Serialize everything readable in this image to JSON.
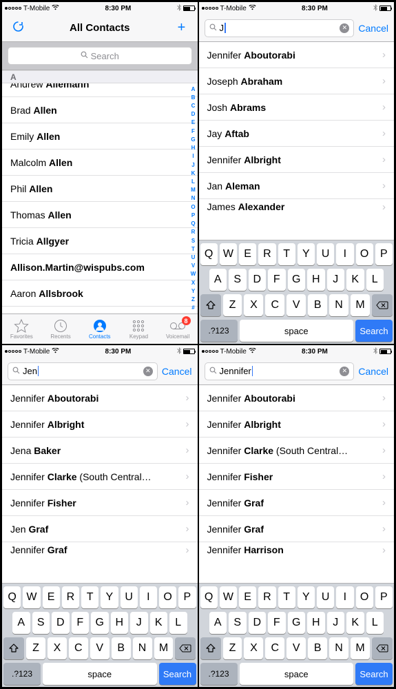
{
  "status": {
    "carrier": "T-Mobile",
    "time": "8:30 PM"
  },
  "screen1": {
    "title": "All Contacts",
    "search_placeholder": "Search",
    "section": "A",
    "rows": [
      {
        "first": "Andrew",
        "last": "Allemann",
        "cut": true
      },
      {
        "first": "Brad",
        "last": "Allen"
      },
      {
        "first": "Emily",
        "last": "Allen"
      },
      {
        "first": "Malcolm",
        "last": "Allen"
      },
      {
        "first": "Phil",
        "last": "Allen"
      },
      {
        "first": "Thomas",
        "last": "Allen"
      },
      {
        "first": "Tricia",
        "last": "Allgyer"
      },
      {
        "first": "",
        "last": "Allison.Martin@wispubs.com"
      },
      {
        "first": "Aaron",
        "last": "Allsbrook"
      }
    ],
    "index": [
      "A",
      "B",
      "C",
      "D",
      "E",
      "F",
      "G",
      "H",
      "I",
      "J",
      "K",
      "L",
      "M",
      "N",
      "O",
      "P",
      "Q",
      "R",
      "S",
      "T",
      "U",
      "V",
      "W",
      "X",
      "Y",
      "Z",
      "#"
    ],
    "tabs": [
      {
        "id": "favorites",
        "label": "Favorites"
      },
      {
        "id": "recents",
        "label": "Recents"
      },
      {
        "id": "contacts",
        "label": "Contacts",
        "active": true
      },
      {
        "id": "keypad",
        "label": "Keypad"
      },
      {
        "id": "voicemail",
        "label": "Voicemail",
        "badge": "8"
      }
    ]
  },
  "screen2": {
    "query": "J",
    "cancel": "Cancel",
    "rows": [
      {
        "first": "Jennifer",
        "last": "Aboutorabi"
      },
      {
        "first": "Joseph",
        "last": "Abraham"
      },
      {
        "first": "Josh",
        "last": "Abrams"
      },
      {
        "first": "Jay",
        "last": "Aftab"
      },
      {
        "first": "Jennifer",
        "last": "Albright"
      },
      {
        "first": "Jan",
        "last": "Aleman"
      },
      {
        "first": "James",
        "last": "Alexander",
        "cutbottom": true
      }
    ]
  },
  "screen3": {
    "query": "Jen",
    "cancel": "Cancel",
    "rows": [
      {
        "first": "Jennifer",
        "last": "Aboutorabi"
      },
      {
        "first": "Jennifer",
        "last": "Albright"
      },
      {
        "first": "Jena",
        "last": "Baker"
      },
      {
        "first": "Jennifer",
        "last": "Clarke",
        "suffix": " (South Central…"
      },
      {
        "first": "Jennifer",
        "last": "Fisher"
      },
      {
        "first": "Jen",
        "last": "Graf"
      },
      {
        "first": "Jennifer",
        "last": "Graf",
        "cutbottom": true
      }
    ]
  },
  "screen4": {
    "query": "Jennifer",
    "cancel": "Cancel",
    "rows": [
      {
        "first": "Jennifer",
        "last": "Aboutorabi"
      },
      {
        "first": "Jennifer",
        "last": "Albright"
      },
      {
        "first": "Jennifer",
        "last": "Clarke",
        "suffix": " (South Central…"
      },
      {
        "first": "Jennifer",
        "last": "Fisher"
      },
      {
        "first": "Jennifer",
        "last": "Graf"
      },
      {
        "first": "Jennifer",
        "last": "Graf"
      },
      {
        "first": "Jennifer",
        "last": "Harrison",
        "cutbottom": true
      }
    ]
  },
  "keyboard": {
    "row1": [
      "Q",
      "W",
      "E",
      "R",
      "T",
      "Y",
      "U",
      "I",
      "O",
      "P"
    ],
    "row2": [
      "A",
      "S",
      "D",
      "F",
      "G",
      "H",
      "J",
      "K",
      "L"
    ],
    "row3": [
      "Z",
      "X",
      "C",
      "V",
      "B",
      "N",
      "M"
    ],
    "mode": ".?123",
    "space": "space",
    "search": "Search"
  }
}
